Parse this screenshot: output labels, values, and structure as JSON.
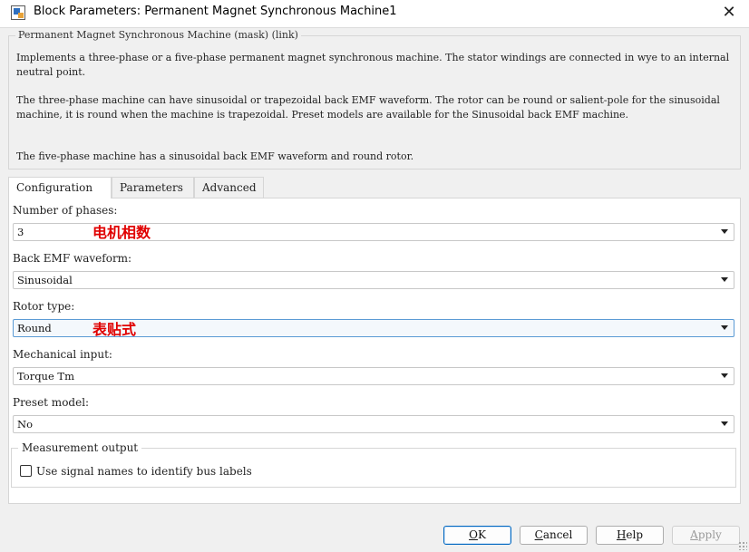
{
  "window": {
    "title": "Block Parameters: Permanent Magnet Synchronous Machine1",
    "close_glyph": "✕",
    "icon": "simulink-block-icon"
  },
  "mask": {
    "legend": "Permanent Magnet Synchronous Machine (mask) (link)",
    "description": [
      "Implements a three-phase or a five-phase permanent magnet synchronous machine. The stator windings are connected in wye to an internal neutral point.",
      "The three-phase machine can have sinusoidal or trapezoidal back EMF waveform. The rotor can be round or salient-pole for the sinusoidal machine, it is round when the machine is trapezoidal. Preset models are available for the Sinusoidal back EMF machine.",
      "The five-phase machine has a sinusoidal back EMF waveform and round rotor."
    ]
  },
  "tabs": [
    {
      "label": "Configuration",
      "active": true
    },
    {
      "label": "Parameters",
      "active": false
    },
    {
      "label": "Advanced",
      "active": false
    }
  ],
  "fields": {
    "phases": {
      "label": "Number of phases:",
      "value": "3",
      "note": "电机相数"
    },
    "back_emf": {
      "label": "Back EMF waveform:",
      "value": "Sinusoidal"
    },
    "rotor": {
      "label": "Rotor type:",
      "value": "Round",
      "note": "表贴式"
    },
    "mech_input": {
      "label": "Mechanical input:",
      "value": "Torque Tm"
    },
    "preset": {
      "label": "Preset model:",
      "value": "No"
    }
  },
  "measurement": {
    "legend": "Measurement output",
    "checkbox_label": "Use signal names to identify bus labels",
    "checked": false
  },
  "buttons": {
    "ok": {
      "label": "OK",
      "underline": "O",
      "rest": "K"
    },
    "cancel": {
      "label": "Cancel",
      "underline": "C",
      "rest": "ancel"
    },
    "help": {
      "label": "Help",
      "underline": "H",
      "rest": "elp"
    },
    "apply": {
      "label": "Apply",
      "underline": "A",
      "rest": "pply",
      "disabled": true
    }
  },
  "colors": {
    "note": "#e00000",
    "focus_border": "#5b9bd5",
    "default_button_border": "#0067c0"
  }
}
